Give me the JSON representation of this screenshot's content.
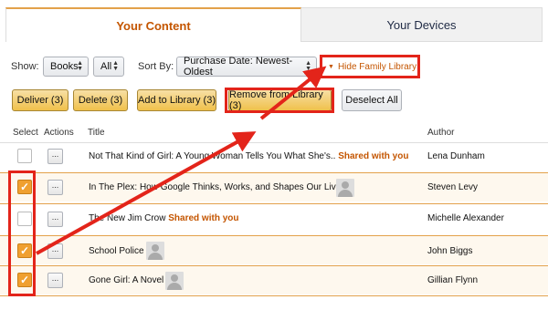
{
  "tabs": [
    {
      "label": "Your Content",
      "active": true
    },
    {
      "label": "Your Devices",
      "active": false
    }
  ],
  "filters": {
    "show_label": "Show:",
    "type_value": "Books",
    "scope_value": "All",
    "sort_label": "Sort By:",
    "sort_value": "Purchase Date: Newest-Oldest",
    "hide_family_label": "Hide Family Library"
  },
  "actions": {
    "deliver": "Deliver (3)",
    "delete": "Delete (3)",
    "add_to_library": "Add to Library (3)",
    "remove_from_library": "Remove from Library (3)",
    "deselect_all": "Deselect All"
  },
  "table": {
    "headers": {
      "select": "Select",
      "actions": "Actions",
      "title": "Title",
      "author": "Author"
    },
    "action_button_label": "...",
    "rows": [
      {
        "title": "Not That Kind of Girl: A Young Woman Tells You What She's..",
        "shared": "Shared with you",
        "author": "Lena Dunham",
        "checked": false,
        "avatar": false
      },
      {
        "title": "In The Plex: How Google Thinks, Works, and Shapes Our Lives",
        "shared": "",
        "author": "Steven Levy",
        "checked": true,
        "avatar": true
      },
      {
        "title": "The New Jim Crow",
        "shared": "Shared with you",
        "author": "Michelle Alexander",
        "checked": false,
        "avatar": false
      },
      {
        "title": "School Police",
        "shared": "",
        "author": "John Biggs",
        "checked": true,
        "avatar": true
      },
      {
        "title": "Gone Girl: A Novel",
        "shared": "",
        "author": "Gillian Flynn",
        "checked": true,
        "avatar": true
      }
    ]
  },
  "colors": {
    "accent": "#c45500",
    "highlight_red": "#e3241a",
    "checkbox_orange": "#f0a030",
    "button_yellow": "#f0c14b"
  }
}
